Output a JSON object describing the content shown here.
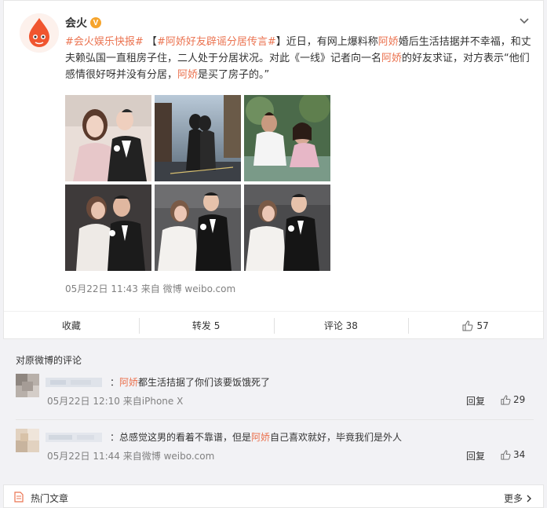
{
  "post": {
    "author": "会火",
    "verified_badge": "V",
    "text_segments": [
      {
        "t": "#会火娱乐快报#",
        "cls": "topic"
      },
      {
        "t": " 【",
        "cls": ""
      },
      {
        "t": "#阿娇好友辟谣分居传言#",
        "cls": "link-topic"
      },
      {
        "t": "】近日，有网上爆料称",
        "cls": ""
      },
      {
        "t": "阿娇",
        "cls": "hl"
      },
      {
        "t": "婚后生活拮据并不幸福，和丈夫赖弘国一直租房子住，二人处于分居状况。对此《一线》记者向一名",
        "cls": ""
      },
      {
        "t": "阿娇",
        "cls": "hl"
      },
      {
        "t": "的好友求证，对方表示“他们感情很好呀并没有分居，",
        "cls": ""
      },
      {
        "t": "阿娇",
        "cls": "hl"
      },
      {
        "t": "是买了房子的。”",
        "cls": ""
      }
    ],
    "timestamp": "05月22日 11:43",
    "source_prefix": "来自",
    "source": "微博 weibo.com"
  },
  "actions": {
    "favorite": "收藏",
    "repost": "转发 5",
    "comment": "评论 38",
    "like_count": "57"
  },
  "comments": {
    "title": "对原微博的评论",
    "items": [
      {
        "name_suffix": "：",
        "segments": [
          {
            "t": "阿娇",
            "cls": "hl"
          },
          {
            "t": "都生活拮据了你们该要饭饿死了",
            "cls": ""
          }
        ],
        "time": "05月22日 12:10",
        "source": "来自iPhone X",
        "reply": "回复",
        "likes": "29"
      },
      {
        "name_suffix": "：",
        "segments": [
          {
            "t": "总感觉这男的看着不靠谱，但是",
            "cls": ""
          },
          {
            "t": "阿娇",
            "cls": "hl"
          },
          {
            "t": "自己喜欢就好，毕竟我们是外人",
            "cls": ""
          }
        ],
        "time": "05月22日 11:44",
        "source": "来自微博 weibo.com",
        "reply": "回复",
        "likes": "34"
      }
    ]
  },
  "footer": {
    "title": "热门文章",
    "more": "更多"
  },
  "colors": {
    "accent": "#eb7350",
    "badge": "#f6a42c",
    "meta": "#808080"
  },
  "icons": {
    "avatar": "fire-drop-logo",
    "chevron": "chevron-down-icon",
    "like": "thumbs-up-icon",
    "doc": "document-icon",
    "more": "chevron-right-icon"
  }
}
